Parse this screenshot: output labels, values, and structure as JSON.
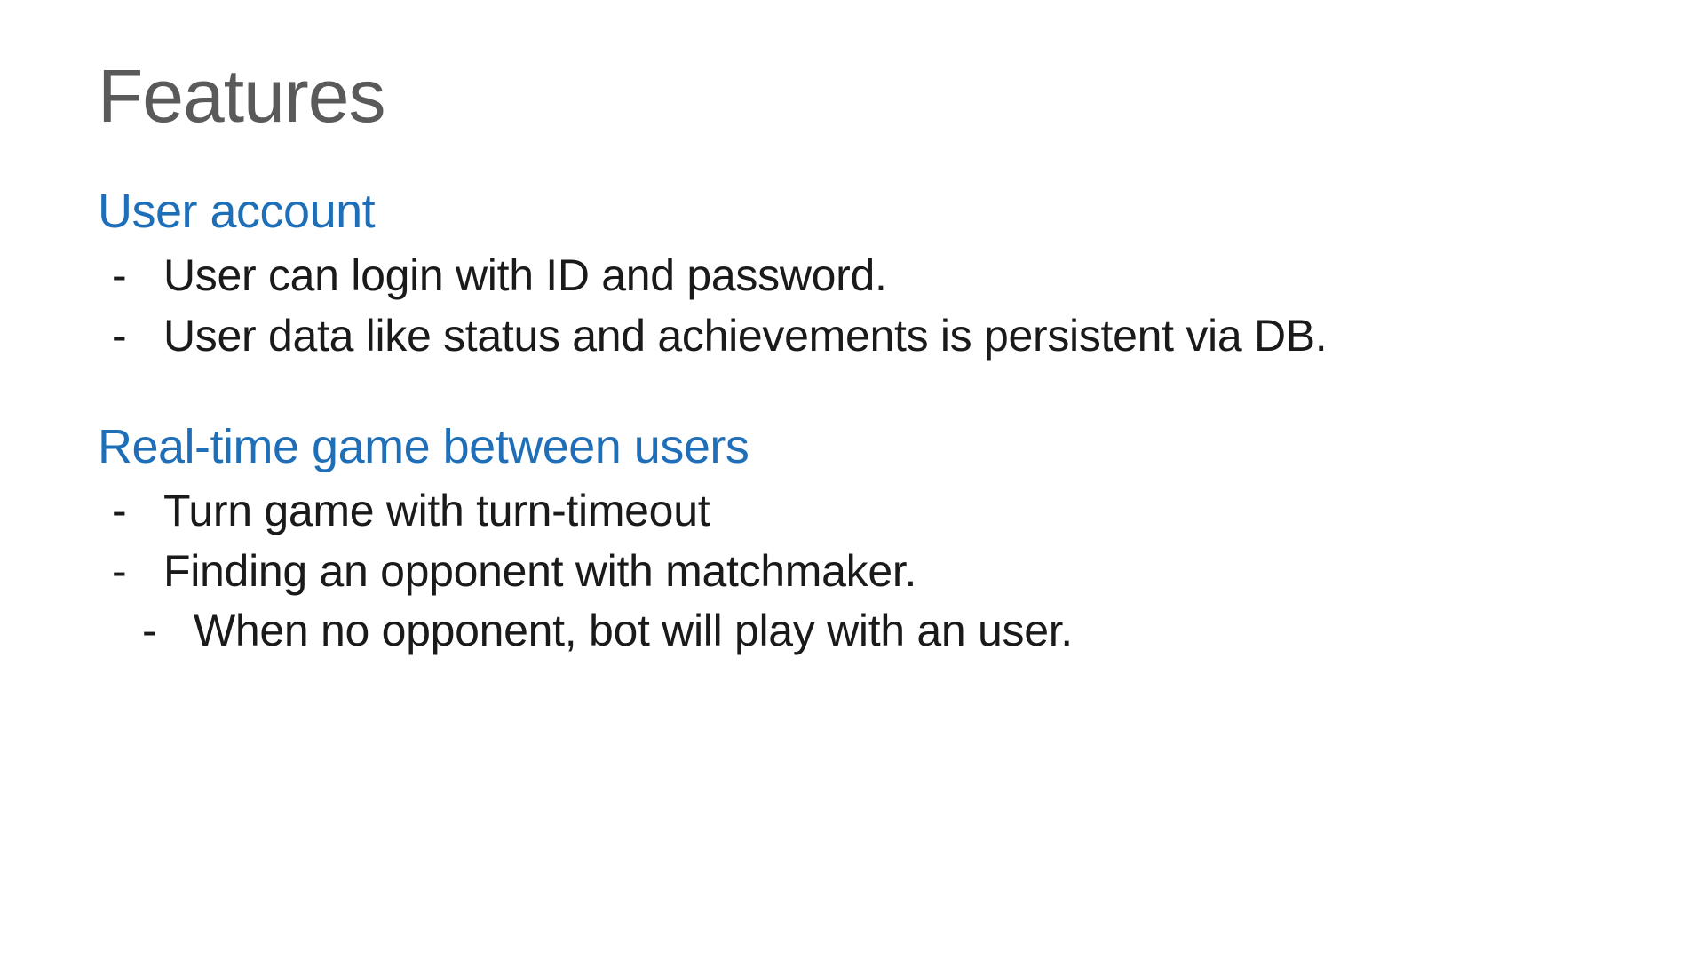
{
  "title": "Features",
  "sections": [
    {
      "heading": "User account",
      "bullets": [
        {
          "text": "User can login with ID and password.",
          "indent": false
        },
        {
          "text": "User data like status and achievements is persistent via DB.",
          "indent": false
        }
      ]
    },
    {
      "heading": "Real-time game between users",
      "bullets": [
        {
          "text": "Turn game with turn-timeout",
          "indent": false
        },
        {
          "text": "Finding an opponent with matchmaker.",
          "indent": false
        },
        {
          "text": "When no opponent, bot will play with an user.",
          "indent": true
        }
      ]
    }
  ],
  "colors": {
    "title": "#5a5a5a",
    "heading": "#1F6FB8",
    "body": "#1a1a1a",
    "background": "#ffffff"
  }
}
